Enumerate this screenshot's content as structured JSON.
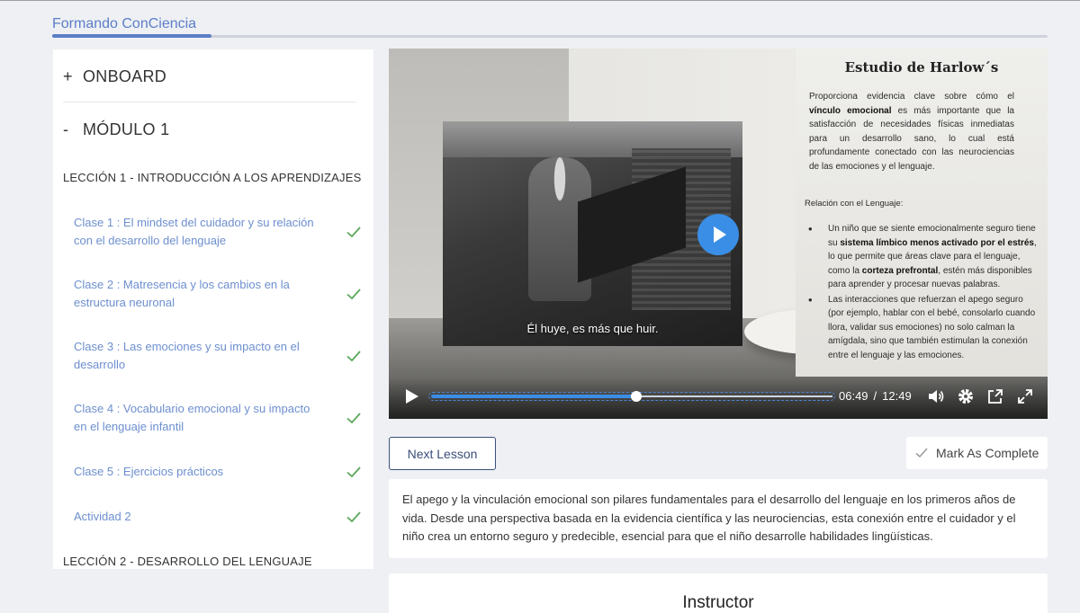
{
  "app": {
    "title": "Formando ConCiencia"
  },
  "sidebar": {
    "sections": [
      {
        "sign": "+",
        "label": "ONBOARD"
      },
      {
        "sign": "-",
        "label": "MÓDULO 1"
      }
    ],
    "lesson1": "LECCIÓN 1 - INTRODUCCIÓN A LOS APRENDIZAJES",
    "items": [
      {
        "label": "Clase 1 : El mindset del cuidador y su relación con el desarrollo del lenguaje",
        "completed": true
      },
      {
        "label": "Clase 2 : Matresencia y los cambios en la estructura neuronal",
        "completed": true
      },
      {
        "label": "Clase 3 : Las emociones y su impacto en el desarrollo",
        "completed": true
      },
      {
        "label": "Clase 4 : Vocabulario emocional y su impacto en el lenguaje infantil",
        "completed": true
      },
      {
        "label": "Clase 5 : Ejercicios prácticos",
        "completed": true
      },
      {
        "label": "Actividad 2",
        "completed": true
      }
    ],
    "lesson2": "LECCIÓN 2 - DESARROLLO DEL LENGUAJE"
  },
  "video": {
    "slide_title": "Estudio de Harlow´s",
    "slide_p1_a": "Proporciona evidencia clave sobre cómo el ",
    "slide_p1_b": "vínculo emocional",
    "slide_p1_c": " es más importante que la satisfacción de necesidades físicas inmediatas para un desarrollo sano, lo cual está profundamente conectado con las neurociencias de las emociones y el lenguaje.",
    "slide_relation": "Relación con el Lenguaje:",
    "bullet1_a": "Un niño que se siente emocionalmente seguro tiene su ",
    "bullet1_b": "sistema límbico menos activado por el estrés",
    "bullet1_c": ", lo que permite que áreas clave para el lenguaje, como la ",
    "bullet1_d": "corteza prefrontal",
    "bullet1_e": ", estén más disponibles para aprender y procesar nuevas palabras.",
    "bullet2": "Las interacciones que refuerzan el apego seguro (por ejemplo, hablar con el bebé, consolarlo cuando llora, validar sus emociones) no solo calman la amígdala, sino que también estimulan la conexión entre el lenguaje y las emociones.",
    "subtitle": "Él huye, es más que huir.",
    "current_time": "06:49",
    "separator": "/",
    "duration": "12:49",
    "progress": 0.51,
    "accent_color": "#3a8ee6"
  },
  "actions": {
    "next_lesson": "Next Lesson",
    "mark_complete": "Mark As Complete"
  },
  "description": "El apego y la vinculación emocional son pilares fundamentales para el desarrollo del lenguaje en los primeros años de vida. Desde una perspectiva basada en la evidencia científica y las neurociencias, esta conexión entre el cuidador y el niño crea un entorno seguro y predecible, esencial para que el niño desarrolle habilidades lingüísticas.",
  "instructor": {
    "heading": "Instructor"
  }
}
